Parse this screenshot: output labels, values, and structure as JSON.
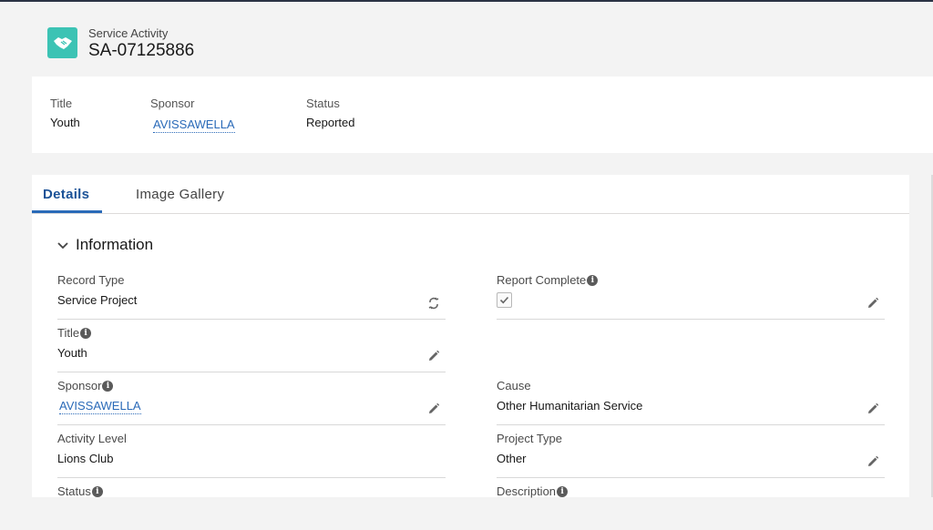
{
  "header": {
    "object_type": "Service Activity",
    "record_name": "SA-07125886",
    "icon": "handshake-icon",
    "icon_color": "#3cc3b4"
  },
  "highlights": [
    {
      "label": "Title",
      "value": "Youth",
      "link": false
    },
    {
      "label": "Sponsor",
      "value": "AVISSAWELLA",
      "link": true
    },
    {
      "label": "Status",
      "value": "Reported",
      "link": false
    }
  ],
  "tabs": [
    {
      "label": "Details",
      "active": true
    },
    {
      "label": "Image Gallery",
      "active": false
    }
  ],
  "section": {
    "title": "Information",
    "expanded": true
  },
  "fields": {
    "record_type": {
      "label": "Record Type",
      "value": "Service Project"
    },
    "report_complete": {
      "label": "Report Complete",
      "checked": true
    },
    "title": {
      "label": "Title",
      "value": "Youth"
    },
    "sponsor": {
      "label": "Sponsor",
      "value": "AVISSAWELLA"
    },
    "cause": {
      "label": "Cause",
      "value": "Other Humanitarian Service"
    },
    "activity_level": {
      "label": "Activity Level",
      "value": "Lions Club"
    },
    "project_type": {
      "label": "Project Type",
      "value": "Other"
    },
    "status": {
      "label": "Status",
      "value": ""
    },
    "description": {
      "label": "Description",
      "value": ""
    }
  },
  "colors": {
    "link": "#2a6ab8",
    "active_tab": "#1b5297",
    "accent": "#2a6ab8"
  }
}
